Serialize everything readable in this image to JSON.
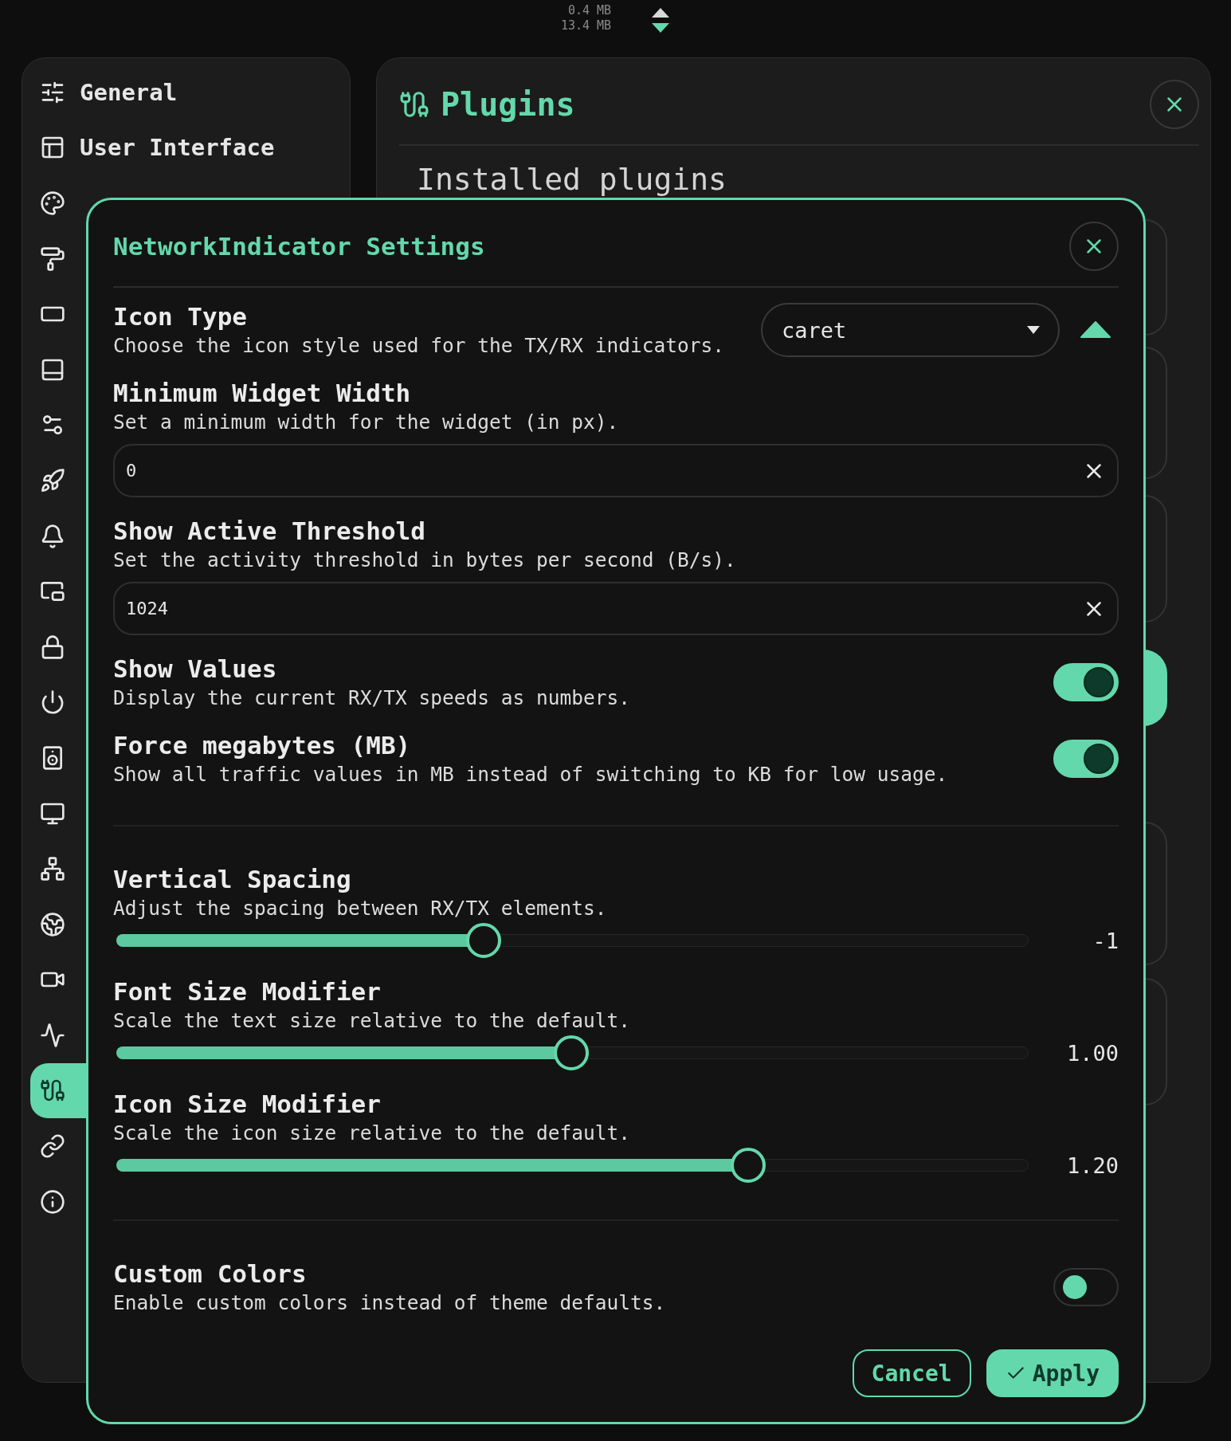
{
  "traffic": {
    "upload": "0.4 MB",
    "download": "13.4 MB"
  },
  "sidebar": {
    "items": [
      {
        "label": "General",
        "selected": false
      },
      {
        "label": "User Interface",
        "selected": false
      },
      {
        "selected": false
      },
      {
        "selected": false
      },
      {
        "selected": false
      },
      {
        "selected": false
      },
      {
        "selected": false
      },
      {
        "selected": false
      },
      {
        "selected": false
      },
      {
        "selected": false
      },
      {
        "selected": false
      },
      {
        "selected": false
      },
      {
        "selected": false
      },
      {
        "selected": false
      },
      {
        "selected": false
      },
      {
        "selected": false
      },
      {
        "selected": false
      },
      {
        "selected": false
      },
      {
        "selected": true
      },
      {
        "selected": false
      },
      {
        "selected": false
      }
    ]
  },
  "plugins_panel": {
    "title": "Plugins",
    "heading": "Installed plugins"
  },
  "dialog": {
    "title": "NetworkIndicator Settings",
    "settings": [
      {
        "kind": "select",
        "title": "Icon Type",
        "description": "Choose the icon style used for the TX/RX indicators.",
        "value": "caret"
      },
      {
        "kind": "text",
        "title": "Minimum Widget Width",
        "description": "Set a minimum width for the widget (in px).",
        "value": "0"
      },
      {
        "kind": "text",
        "title": "Show Active Threshold",
        "description": "Set the activity threshold in bytes per second (B/s).",
        "value": "1024"
      },
      {
        "kind": "toggle",
        "title": "Show Values",
        "description": "Display the current RX/TX speeds as numbers.",
        "on": true
      },
      {
        "kind": "toggle",
        "title": "Force megabytes (MB)",
        "description": "Show all traffic values in MB instead of switching to KB for low usage.",
        "on": true
      },
      {
        "kind": "divider"
      },
      {
        "kind": "slider",
        "title": "Vertical Spacing",
        "description": "Adjust the spacing between RX/TX elements.",
        "level": 0.403,
        "reading": "-1"
      },
      {
        "kind": "slider",
        "title": "Font Size Modifier",
        "description": "Scale the text size relative to the default.",
        "level": 0.499,
        "reading": "1.00"
      },
      {
        "kind": "slider",
        "title": "Icon Size Modifier",
        "description": "Scale the icon size relative to the default.",
        "level": 0.693,
        "reading": "1.20"
      },
      {
        "kind": "divider"
      },
      {
        "kind": "toggle",
        "title": "Custom Colors",
        "description": "Enable custom colors instead of theme defaults.",
        "on": false
      }
    ],
    "buttons": [
      {
        "label": "Cancel",
        "kind": "secondary"
      },
      {
        "label": "Apply",
        "kind": "primary"
      }
    ]
  }
}
